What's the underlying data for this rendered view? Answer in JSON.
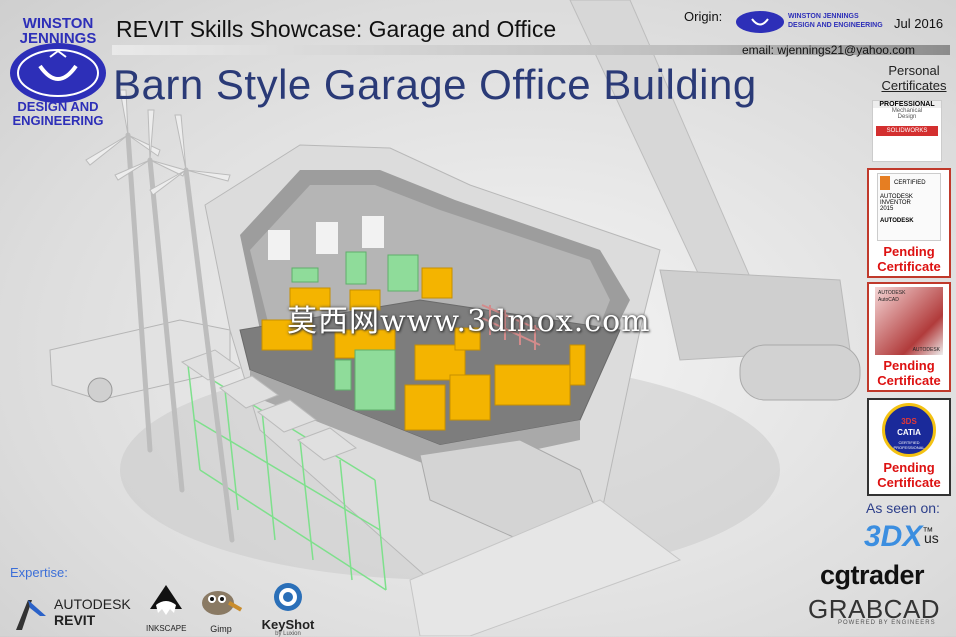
{
  "company": {
    "name_line1": "WINSTON",
    "name_line2": "JENNINGS",
    "tag_line1": "DESIGN AND",
    "tag_line2": "ENGINEERING"
  },
  "header": {
    "subtitle": "REVIT Skills Showcase: Garage and Office",
    "title": "Barn Style Garage Office Building",
    "origin_label": "Origin:",
    "origin_logo_line1": "WINSTON JENNINGS",
    "origin_logo_line2": "DESIGN AND ENGINEERING",
    "date": "Jul 2016",
    "email": "email: wjennings21@yahoo.com"
  },
  "certificates": {
    "heading_line1": "Personal",
    "heading_line2": "Certificates",
    "items": [
      {
        "badge": "PROFESSIONAL",
        "line1": "Mechanical",
        "line2": "Design",
        "vendor": "SOLIDWORKS",
        "status": ""
      },
      {
        "badge": "CERTIFIED",
        "line1": "AUTODESK",
        "line2": "INVENTOR",
        "line3": "2015",
        "vendor": "AUTODESK",
        "status_line1": "Pending",
        "status_line2": "Certificate"
      },
      {
        "badge": "AUTODESK",
        "line1": "AutoCAD",
        "line2": "",
        "vendor": "AUTODESK",
        "status_line1": "Pending",
        "status_line2": "Certificate"
      },
      {
        "badge": "CATIA",
        "line1": "CERTIFIED PROFESSIONAL",
        "vendor": "3DS",
        "status_line1": "Pending",
        "status_line2": "Certificate"
      }
    ]
  },
  "seen_on": {
    "label": "As seen on:",
    "brand1": "3DX",
    "brand1_sup": "™",
    "brand1_suffix": "us",
    "brand2": "cgtrader",
    "brand3": "GRABCAD",
    "brand3_sub": "POWERED BY ENGINEERS"
  },
  "expertise": {
    "label": "Expertise:",
    "tools": [
      {
        "name_line1": "AUTODESK",
        "name_line2": "REVIT",
        "icon": "revit-icon"
      },
      {
        "name": "INKSCAPE",
        "icon": "inkscape-icon"
      },
      {
        "name": "Gimp",
        "icon": "gimp-icon"
      },
      {
        "name": "KeyShot",
        "sub": "by Luxion",
        "icon": "keyshot-icon"
      }
    ]
  },
  "watermark": "莫西网www.3dmox.com",
  "colors": {
    "brand_blue": "#2d2fb8",
    "title_blue": "#2a3a77",
    "pending_red": "#d11111",
    "furniture_yellow": "#f4b400",
    "furniture_green": "#8fdc9a"
  }
}
